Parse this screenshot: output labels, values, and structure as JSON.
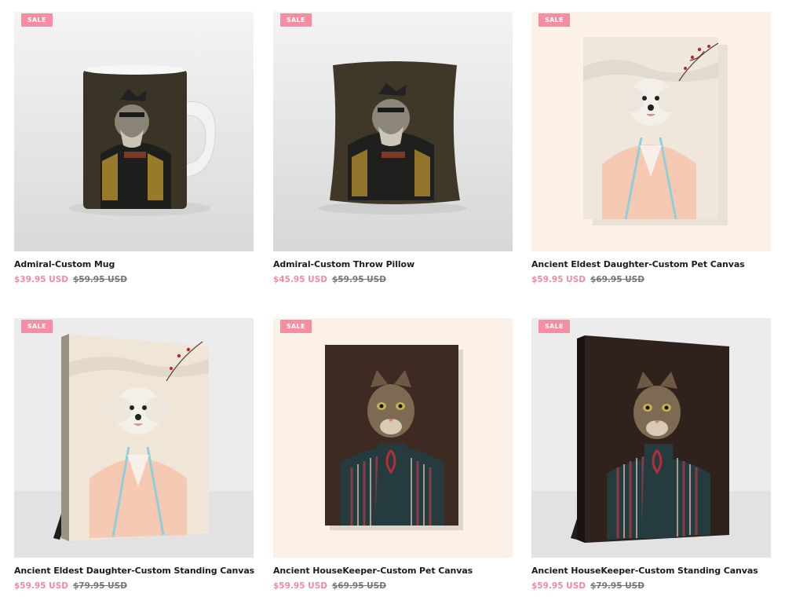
{
  "colors": {
    "sale_badge": "#f78ca2",
    "sale_price": "#f28aa0",
    "old_price": "#777777",
    "title": "#1c1c1c"
  },
  "products": [
    {
      "badge": "SALE",
      "title": "Admiral-Custom Mug",
      "price": "$39.95 USD",
      "compare_price": "$59.95 USD",
      "image": "mug-dog-admiral"
    },
    {
      "badge": "SALE",
      "title": "Admiral-Custom Throw Pillow",
      "price": "$45.95 USD",
      "compare_price": "$59.95 USD",
      "image": "pillow-dog-admiral"
    },
    {
      "badge": "SALE",
      "title": "Ancient Eldest Daughter-Custom Pet Canvas",
      "price": "$59.95 USD",
      "compare_price": "$69.95 USD",
      "image": "canvas-dog-robe"
    },
    {
      "badge": "SALE",
      "title": "Ancient Eldest Daughter-Custom Standing Canvas",
      "price": "$59.95 USD",
      "compare_price": "$79.95 USD",
      "image": "standing-canvas-dog-robe"
    },
    {
      "badge": "SALE",
      "title": "Ancient HouseKeeper-Custom Pet Canvas",
      "price": "$59.95 USD",
      "compare_price": "$69.95 USD",
      "image": "canvas-cat-striped"
    },
    {
      "badge": "SALE",
      "title": "Ancient HouseKeeper-Custom Standing Canvas",
      "price": "$59.95 USD",
      "compare_price": "$79.95 USD",
      "image": "standing-canvas-cat-striped"
    }
  ]
}
